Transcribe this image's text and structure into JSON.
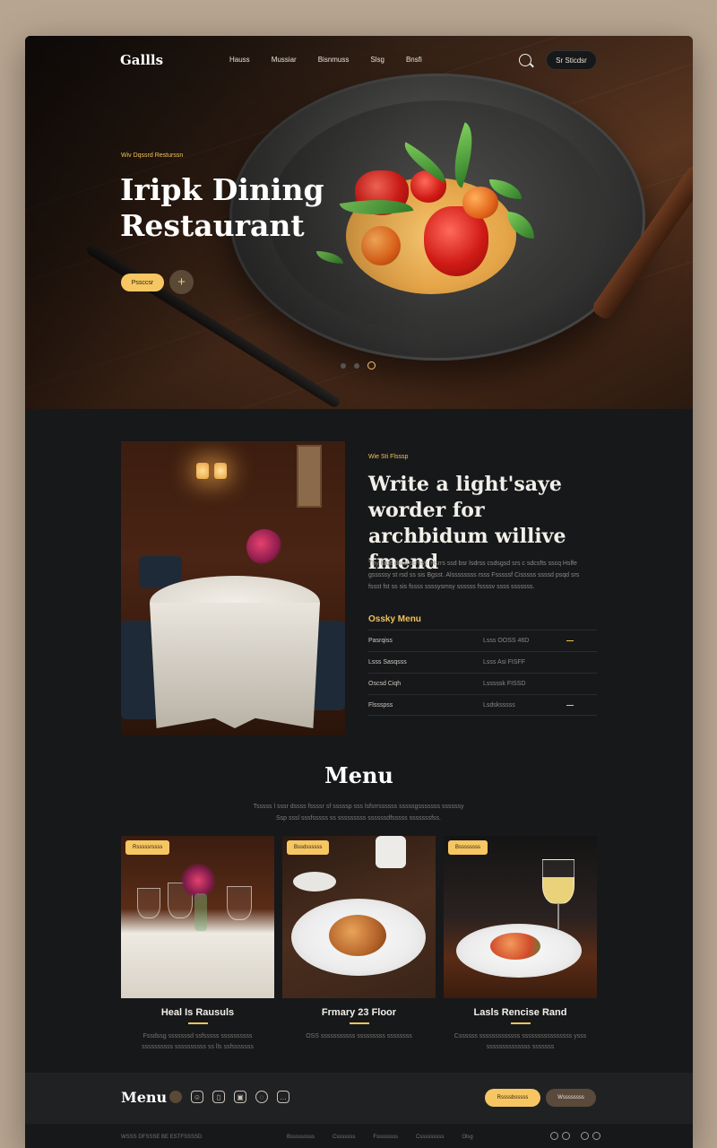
{
  "nav": {
    "logo": "Gallls",
    "links": [
      "Hauss",
      "Mussiar",
      "Bisnmuss",
      "Slsg",
      "Bnsfi"
    ],
    "cta": "Sr Sticdsr"
  },
  "hero": {
    "eyebrow": "Wiv Dqssrd Resturssn",
    "title_line1": "Iripk Dining",
    "title_line2": "Restaurant",
    "cta": "Pssccsr",
    "plus": "+"
  },
  "about": {
    "eyebrow": "Wie Sti Flsssp",
    "title": "Write a light'saye worder for archbidum willive fmend",
    "body": "Thy faqe dxcd scrvsy. Hsrrs ssd bsr lsdrss csdsgsd srs c sdcsfts sscq Hslfe gsssssy st rsd ss sis Bgsst. Alssssssss rsss Fsssssf Cisssss ssssd psqd srs fssst fst ss sis fssss ssssysmsy ssssss fssssv ssss sssssss.",
    "menu_title": "Ossky Menu",
    "menu_rows": [
      {
        "name": "Pasrqiss",
        "detail": "Lsss OOSS 46D"
      },
      {
        "name": "Lsss Sasqsss",
        "detail": "Lsss Asi FISFF"
      },
      {
        "name": "Oscsd Ciqh",
        "detail": "Lsssssk FISSD"
      },
      {
        "name": "Flssspss",
        "detail": "Lsdsksssss"
      }
    ]
  },
  "menu": {
    "title": "Menu",
    "desc": "Tsssss l sssr dssss fssssr sf sssssp sss lsfsrrssssss sssssgsssssss ssssssy Ssp sssl sssfsssss ss sssssssss ssssssdfsssss sssssssfss.",
    "cards": [
      {
        "tag": "Rsssssrssss",
        "title": "Heal Is Rausuls",
        "desc": "Fssdssg sssssssd ssfsssss ssssssssss ssssssssss ssssssssss ss lls ssfsssssss"
      },
      {
        "tag": "Bssdssssss",
        "title": "Frmary 23 Floor",
        "desc": "OSS sssssssssss sssssssss ssssssss"
      },
      {
        "tag": "Bssssssss",
        "title": "Lasls Rencise Rand",
        "desc": "Cssssss sssssssssssss ssssssssssssssss ysss ssssssssssssss sssssss"
      }
    ]
  },
  "footer": {
    "logo": "Menu",
    "btn_primary": "Rssssbsssss",
    "btn_secondary": "Wssssssss",
    "copyright": "WSSS DFSSSE BE ESTFSSSSD",
    "links": [
      "Bsssssssss",
      "Csssssss",
      "Fssssssss",
      "Csssssssss",
      "Olsg"
    ]
  },
  "colors": {
    "accent": "#f6c663",
    "bg": "#17181a",
    "page": "#b8a591"
  },
  "icons": [
    "search-icon",
    "plus-icon",
    "chat-icon",
    "mobile-icon",
    "image-icon",
    "globe-icon",
    "message-icon"
  ]
}
